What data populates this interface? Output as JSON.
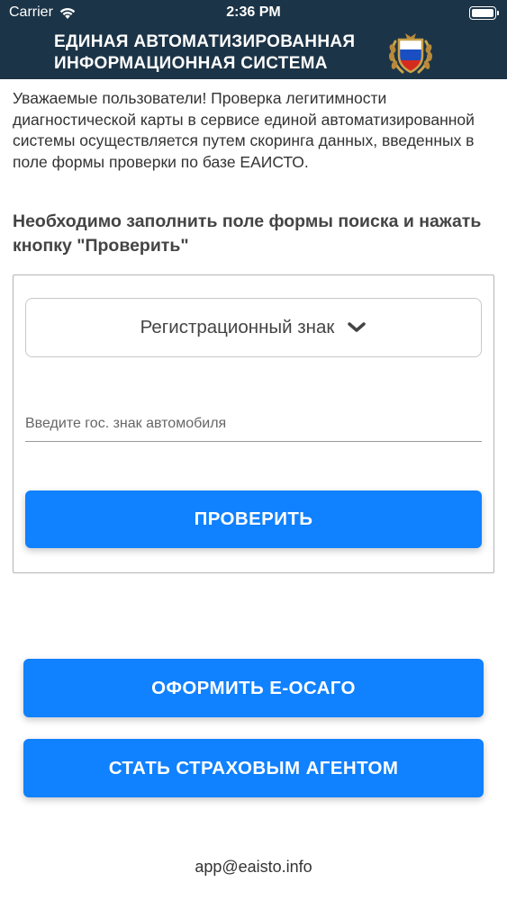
{
  "status_bar": {
    "carrier": "Carrier",
    "time": "2:36 PM",
    "battery_level": 1.0
  },
  "header": {
    "title_line1": "ЕДИНАЯ АВТОМАТИЗИРОВАННАЯ",
    "title_line2": "ИНФОРМАЦИОННАЯ СИСТЕМА",
    "background_color": "#1c3447",
    "emblem_icon": "russian-flag-emblem-icon"
  },
  "intro_text": "Уважаемые пользователи! Проверка легитимности диагностической карты в сервисе единой автоматизированной системы осуществляется путем скоринга данных, введенных в поле формы проверки по базе ЕАИСТО.",
  "instruction_text": "Необходимо заполнить поле формы поиска и нажать кнопку \"Проверить\"",
  "search_form": {
    "search_type_selected": "Регистрационный знак",
    "plate_input_value": "",
    "plate_input_placeholder": "Введите гос. знак автомобиля",
    "check_button_label": "ПРОВЕРИТЬ"
  },
  "actions": {
    "osago_button_label": "ОФОРМИТЬ Е-ОСАГО",
    "agent_button_label": "СТАТЬ СТРАХОВЫМ АГЕНТОМ"
  },
  "footer": {
    "email": "app@eaisto.info"
  },
  "colors": {
    "accent": "#1081ff",
    "header": "#1c3447"
  }
}
